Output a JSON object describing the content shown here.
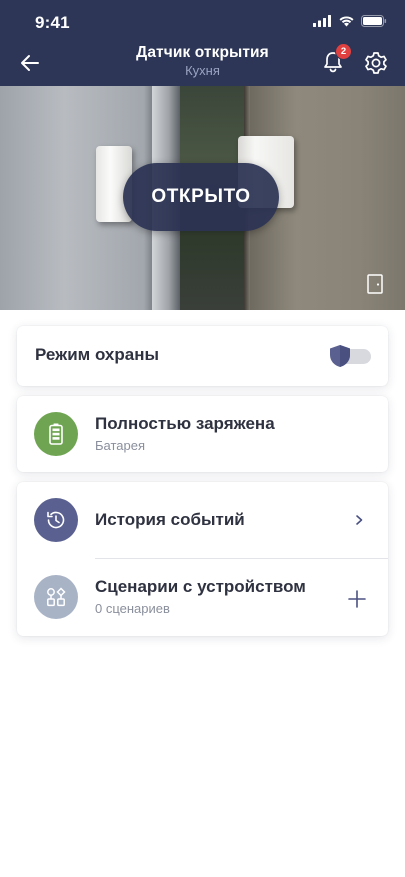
{
  "status_bar": {
    "time": "9:41"
  },
  "header": {
    "title": "Датчик открытия",
    "subtitle": "Кухня",
    "notification_count": "2"
  },
  "hero": {
    "state_label": "ОТКРЫТО"
  },
  "guard": {
    "label": "Режим охраны",
    "enabled": false
  },
  "battery": {
    "title": "Полностью заряжена",
    "subtitle": "Батарея"
  },
  "events": {
    "title": "История событий"
  },
  "scenarios": {
    "title": "Сценарии с устройством",
    "subtitle": "0 сценариев"
  },
  "colors": {
    "header_bg": "#2d3656",
    "battery_icon_bg": "#6fa552",
    "history_icon_bg": "#5a6190",
    "scenario_icon_bg": "#a8b3c6",
    "badge": "#e04040"
  }
}
